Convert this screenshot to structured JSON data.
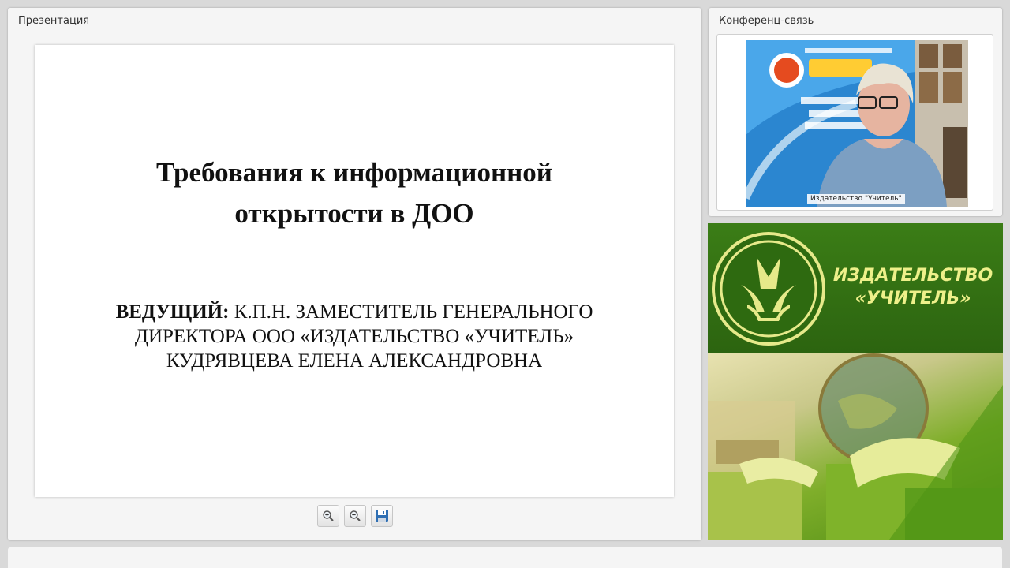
{
  "presentation": {
    "title": "Презентация",
    "slide": {
      "title": "Требования к информационной открытости в ДОО",
      "presenter_label": "ВЕДУЩИЙ:",
      "presenter_text": " К.П.Н. ЗАМЕСТИТЕЛЬ ГЕНЕРАЛЬНОГО ДИРЕКТОРА ООО «ИЗДАТЕЛЬСТВО «УЧИТЕЛЬ» КУДРЯВЦЕВА ЕЛЕНА АЛЕКСАНДРОВНА"
    },
    "toolbar": {
      "zoom_in_icon": "zoom-in-icon",
      "zoom_out_icon": "zoom-out-icon",
      "save_icon": "floppy-disk-icon"
    }
  },
  "conference": {
    "title": "Конференц-связь",
    "participant_label": "Издательство \"Учитель\""
  },
  "branding": {
    "name_line1": "ИЗДАТЕЛЬСТВО",
    "name_line2": "«УЧИТЕЛЬ»",
    "colors": {
      "green": "#2f6b12",
      "text": "#eef08a"
    }
  }
}
